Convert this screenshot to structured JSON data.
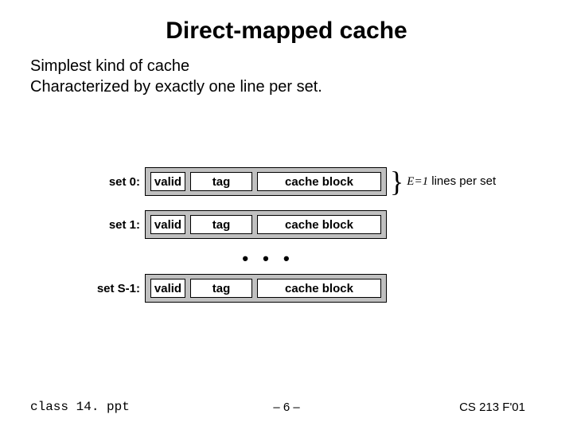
{
  "title": "Direct-mapped cache",
  "intro": {
    "line1": "Simplest kind of cache",
    "line2": "Characterized by exactly one line per set."
  },
  "rows": {
    "labels": {
      "r0": "set 0:",
      "r1": "set 1:",
      "rlast": "set S-1:"
    },
    "cells": {
      "valid": "valid",
      "tag": "tag",
      "block": "cache block"
    }
  },
  "dots": "• • •",
  "brace": {
    "var": "E=1",
    "rest": " lines per set"
  },
  "footer": {
    "left": "class 14. ppt",
    "center": "– 6 –",
    "right": "CS 213 F'01"
  }
}
